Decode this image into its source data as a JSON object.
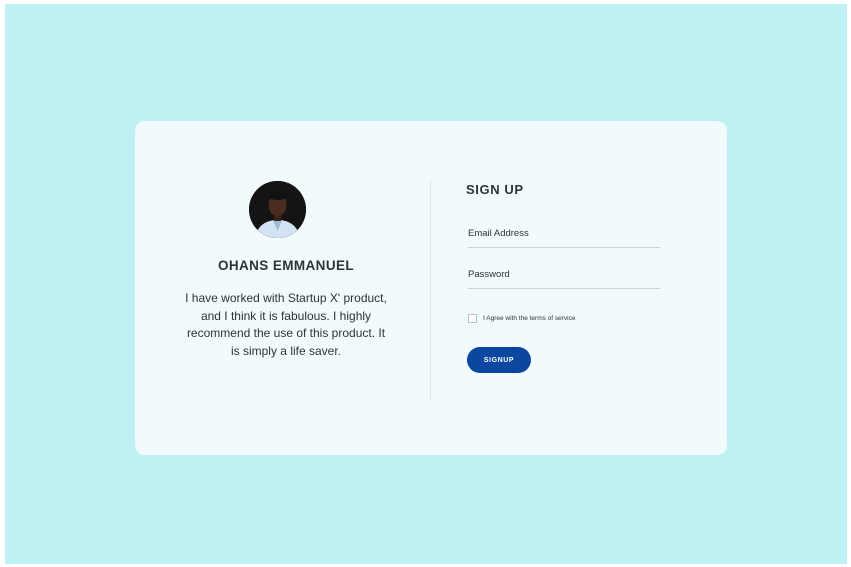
{
  "profile": {
    "name": "OHANS EMMANUEL",
    "testimonial": "I have worked with Startup X' product, and I think it is fabulous. I highly recommend the use of this product. It is simply a life saver."
  },
  "signup": {
    "title": "SIGN UP",
    "email_placeholder": "Email Address",
    "password_placeholder": "Password",
    "terms_label": "I Agree with the terms of service",
    "button_label": "SIGNUP"
  },
  "colors": {
    "page_background": "#bff0f4",
    "card_background": "#f1fafc",
    "button": "#0b47a1",
    "text": "#2d3436"
  }
}
